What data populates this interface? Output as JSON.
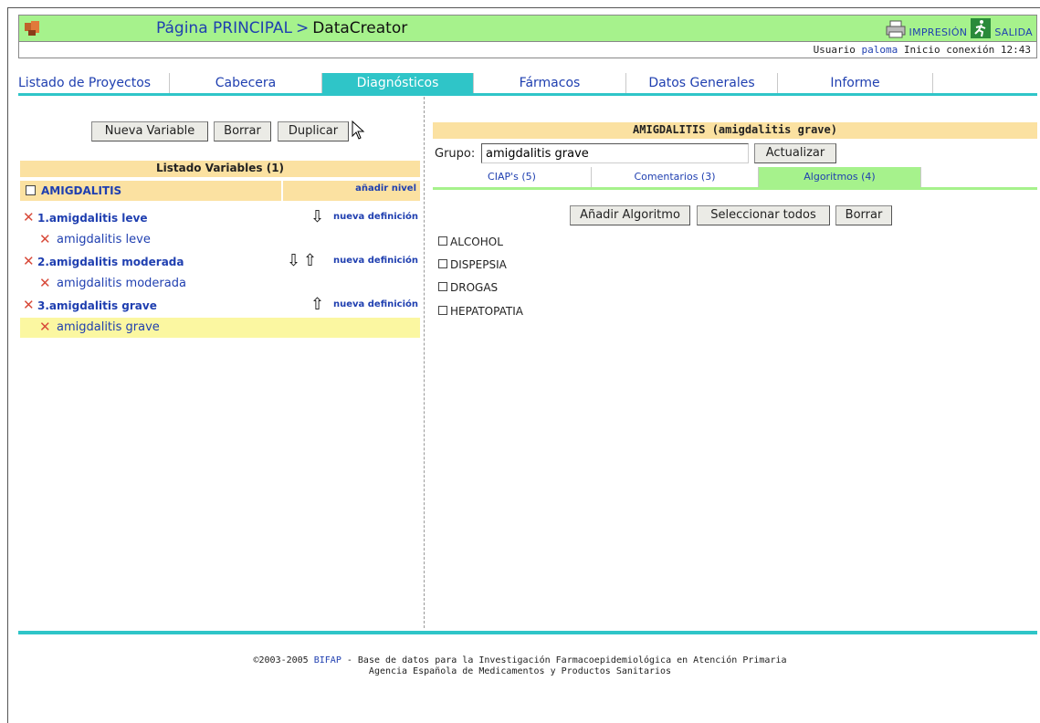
{
  "header": {
    "breadcrumb_home": "Página PRINCIPAL",
    "breadcrumb_separator": ">",
    "breadcrumb_current": "DataCreator",
    "print_label": "IMPRESIÓN",
    "exit_label": "SALIDA"
  },
  "user": {
    "prefix": "Usuario",
    "name": "paloma",
    "session": "Inicio conexión 12:43"
  },
  "tabs": [
    {
      "label": "Listado de Proyectos"
    },
    {
      "label": "Cabecera"
    },
    {
      "label": "Diagnósticos"
    },
    {
      "label": "Fármacos"
    },
    {
      "label": "Datos Generales"
    },
    {
      "label": "Informe"
    }
  ],
  "left": {
    "buttons": {
      "new": "Nueva Variable",
      "delete": "Borrar",
      "duplicate": "Duplicar"
    },
    "list_header": "Listado Variables (1)",
    "root": {
      "name": "AMIGDALITIS",
      "add_level": "añadir nivel"
    },
    "levels": [
      {
        "name": "1.amigdalitis leve",
        "action": "nueva definición",
        "definition": "amigdalitis leve"
      },
      {
        "name": "2.amigdalitis moderada",
        "action": "nueva definición",
        "definition": "amigdalitis moderada"
      },
      {
        "name": "3.amigdalitis grave",
        "action": "nueva definición",
        "definition": "amigdalitis grave"
      }
    ]
  },
  "right": {
    "title": "AMIGDALITIS (amigdalitis grave)",
    "group_label": "Grupo:",
    "group_value": "amigdalitis grave",
    "update_button": "Actualizar",
    "subtabs": [
      {
        "label": "CIAP's (5)"
      },
      {
        "label": "Comentarios (3)"
      },
      {
        "label": "Algoritmos (4)"
      }
    ],
    "buttons": {
      "add": "Añadir Algoritmo",
      "select_all": "Seleccionar todos",
      "delete": "Borrar"
    },
    "algorithms": [
      "ALCOHOL",
      "DISPEPSIA",
      "DROGAS",
      "HEPATOPATIA"
    ]
  },
  "footer": {
    "line1_prefix": "©2003-2005",
    "line1_brand": "BIFAP",
    "line1_rest": "- Base de datos para la Investigación Farmacoepidemiológica en Atención Primaria",
    "line2": "Agencia Española de Medicamentos y Productos Sanitarios"
  },
  "colors": {
    "header_green": "#a6f28c",
    "accent_cyan": "#2fc5c8",
    "panel_orange": "#fbe1a1",
    "selected_yellow": "#fbf7a1",
    "link_blue": "#1f3fb0",
    "delete_red": "#d84a3a"
  },
  "icons": {
    "logo": "app-logo-icon",
    "print": "printer-icon",
    "exit": "exit-door-icon",
    "delete": "delete-x-icon",
    "move_down": "arrow-down-icon",
    "move_up": "arrow-up-icon"
  }
}
